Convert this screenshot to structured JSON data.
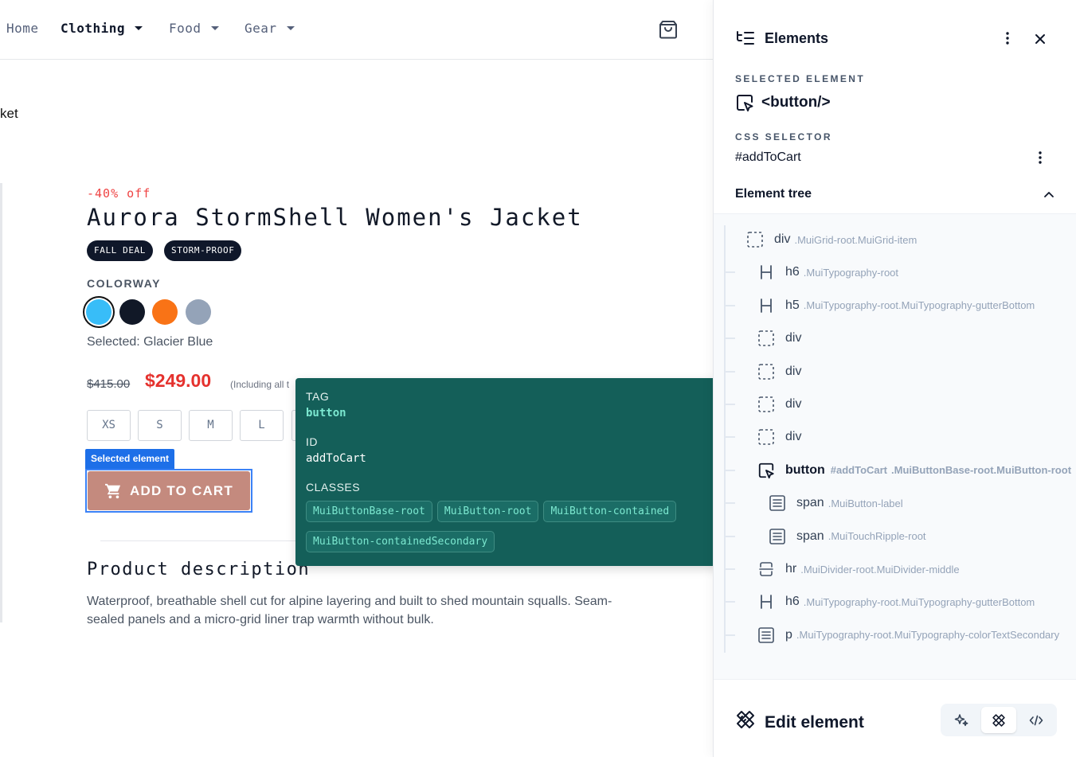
{
  "nav": {
    "items": [
      {
        "label": "Home"
      },
      {
        "label": "Clothing"
      },
      {
        "label": "Food"
      },
      {
        "label": "Gear"
      }
    ]
  },
  "page": {
    "crumb_fragment": "ket"
  },
  "product": {
    "discount": "-40% off",
    "title": "Aurora StormShell Women's Jacket",
    "tags": [
      "FALL DEAL",
      "STORM-PROOF"
    ],
    "colorway_label": "COLORWAY",
    "swatches": [
      "#38bdf8",
      "#111827",
      "#f97316",
      "#94a3b8"
    ],
    "selected_color": "Selected: Glacier Blue",
    "price_old": "$415.00",
    "price_new": "$249.00",
    "price_note": "(Including all t",
    "sizes": [
      "XS",
      "S",
      "M",
      "L"
    ],
    "selected_badge": "Selected element",
    "add_to_cart": "ADD TO CART",
    "description_title": "Product description",
    "description": "Waterproof, breathable shell cut for alpine layering and built to shed mountain squalls. Seam-sealed panels and a micro-grid liner trap warmth without bulk."
  },
  "tooltip": {
    "tag_label": "TAG",
    "tag_value": "button",
    "id_label": "ID",
    "id_value": "addToCart",
    "classes_label": "CLASSES",
    "classes": [
      "MuiButtonBase-root",
      "MuiButton-root",
      "MuiButton-contained",
      "MuiButton-containedSecondary"
    ]
  },
  "panel": {
    "title": "Elements",
    "selected_label": "SELECTED ELEMENT",
    "selected_value": "<button/>",
    "css_label": "CSS SELECTOR",
    "css_value": "#addToCart",
    "tree_title": "Element tree",
    "tree": [
      {
        "icon": "box",
        "tag": "div",
        "id": "",
        "cls": ".MuiGrid-root.MuiGrid-item"
      },
      {
        "icon": "heading",
        "tag": "h6",
        "id": "",
        "cls": ".MuiTypography-root"
      },
      {
        "icon": "heading",
        "tag": "h5",
        "id": "",
        "cls": ".MuiTypography-root.MuiTypography-gutterBottom"
      },
      {
        "icon": "box",
        "tag": "div",
        "id": "",
        "cls": ""
      },
      {
        "icon": "box",
        "tag": "div",
        "id": "",
        "cls": ""
      },
      {
        "icon": "box",
        "tag": "div",
        "id": "",
        "cls": ""
      },
      {
        "icon": "box",
        "tag": "div",
        "id": "",
        "cls": ""
      },
      {
        "icon": "cursor",
        "tag": "button",
        "id": "#addToCart",
        "cls": ".MuiButtonBase-root.MuiButton-root",
        "selected": true
      },
      {
        "icon": "text",
        "tag": "span",
        "id": "",
        "cls": ".MuiButton-label"
      },
      {
        "icon": "text",
        "tag": "span",
        "id": "",
        "cls": ".MuiTouchRipple-root"
      },
      {
        "icon": "divider",
        "tag": "hr",
        "id": "",
        "cls": ".MuiDivider-root.MuiDivider-middle"
      },
      {
        "icon": "heading",
        "tag": "h6",
        "id": "",
        "cls": ".MuiTypography-root.MuiTypography-gutterBottom"
      },
      {
        "icon": "text",
        "tag": "p",
        "id": "",
        "cls": ".MuiTypography-root.MuiTypography-colorTextSecondary"
      }
    ],
    "edit_title": "Edit element"
  }
}
